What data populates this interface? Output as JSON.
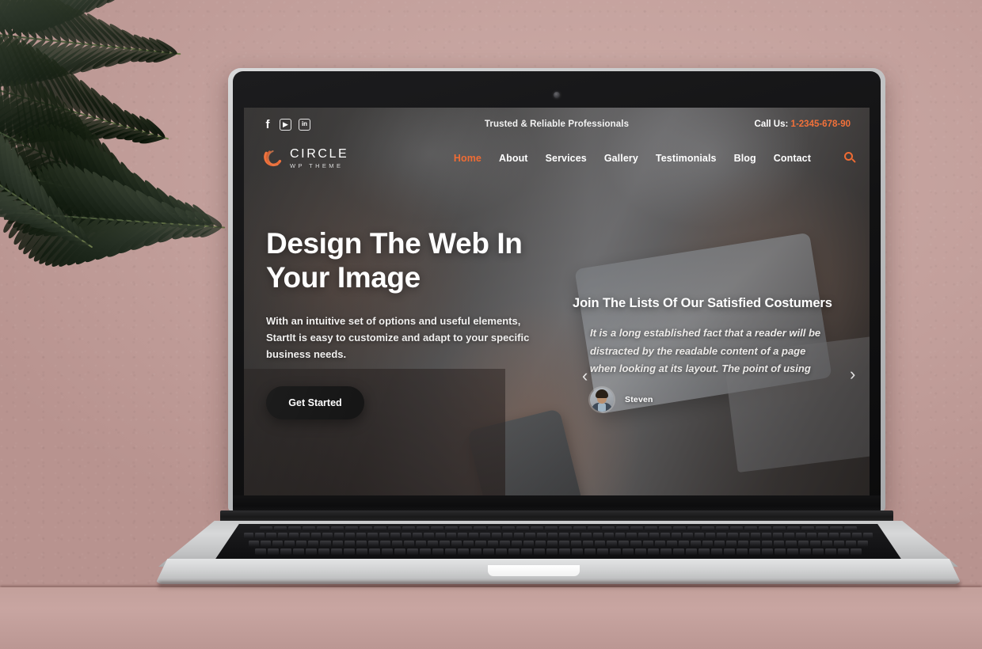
{
  "scene": {
    "background_color": "#c9a8a4",
    "plant": "palm-fronds",
    "device": "laptop"
  },
  "site": {
    "topbar": {
      "socials": [
        {
          "name": "facebook-icon",
          "glyph": "f"
        },
        {
          "name": "youtube-icon",
          "glyph": "▶"
        },
        {
          "name": "linkedin-icon",
          "glyph": "in"
        }
      ],
      "tagline": "Trusted & Reliable Professionals",
      "call_label": "Call Us:",
      "phone": "1-2345-678-90"
    },
    "logo": {
      "name": "CIRCLE",
      "sub": "WP THEME",
      "mark_color": "#ef6b33"
    },
    "nav": {
      "items": [
        {
          "label": "Home",
          "active": true
        },
        {
          "label": "About",
          "active": false
        },
        {
          "label": "Services",
          "active": false
        },
        {
          "label": "Gallery",
          "active": false
        },
        {
          "label": "Testimonials",
          "active": false
        },
        {
          "label": "Blog",
          "active": false
        },
        {
          "label": "Contact",
          "active": false
        }
      ],
      "search_icon": "search-icon"
    },
    "hero": {
      "title_line1": "Design The Web In",
      "title_line2": "Your Image",
      "paragraph": "With an intuitive set of options and useful elements, StartIt is easy to customize and adapt to your specific business needs.",
      "cta_label": "Get Started"
    },
    "testimonial": {
      "heading": "Join The Lists Of Our Satisfied Costumers",
      "quote": "It is a long established fact that a reader will be distracted by the readable content of a page when looking at its layout. The point of using",
      "author": "Steven",
      "prev_arrow": "‹",
      "next_arrow": "›"
    },
    "colors": {
      "accent": "#ef6b33",
      "text": "#ffffff",
      "cta_bg": "#141414"
    }
  }
}
